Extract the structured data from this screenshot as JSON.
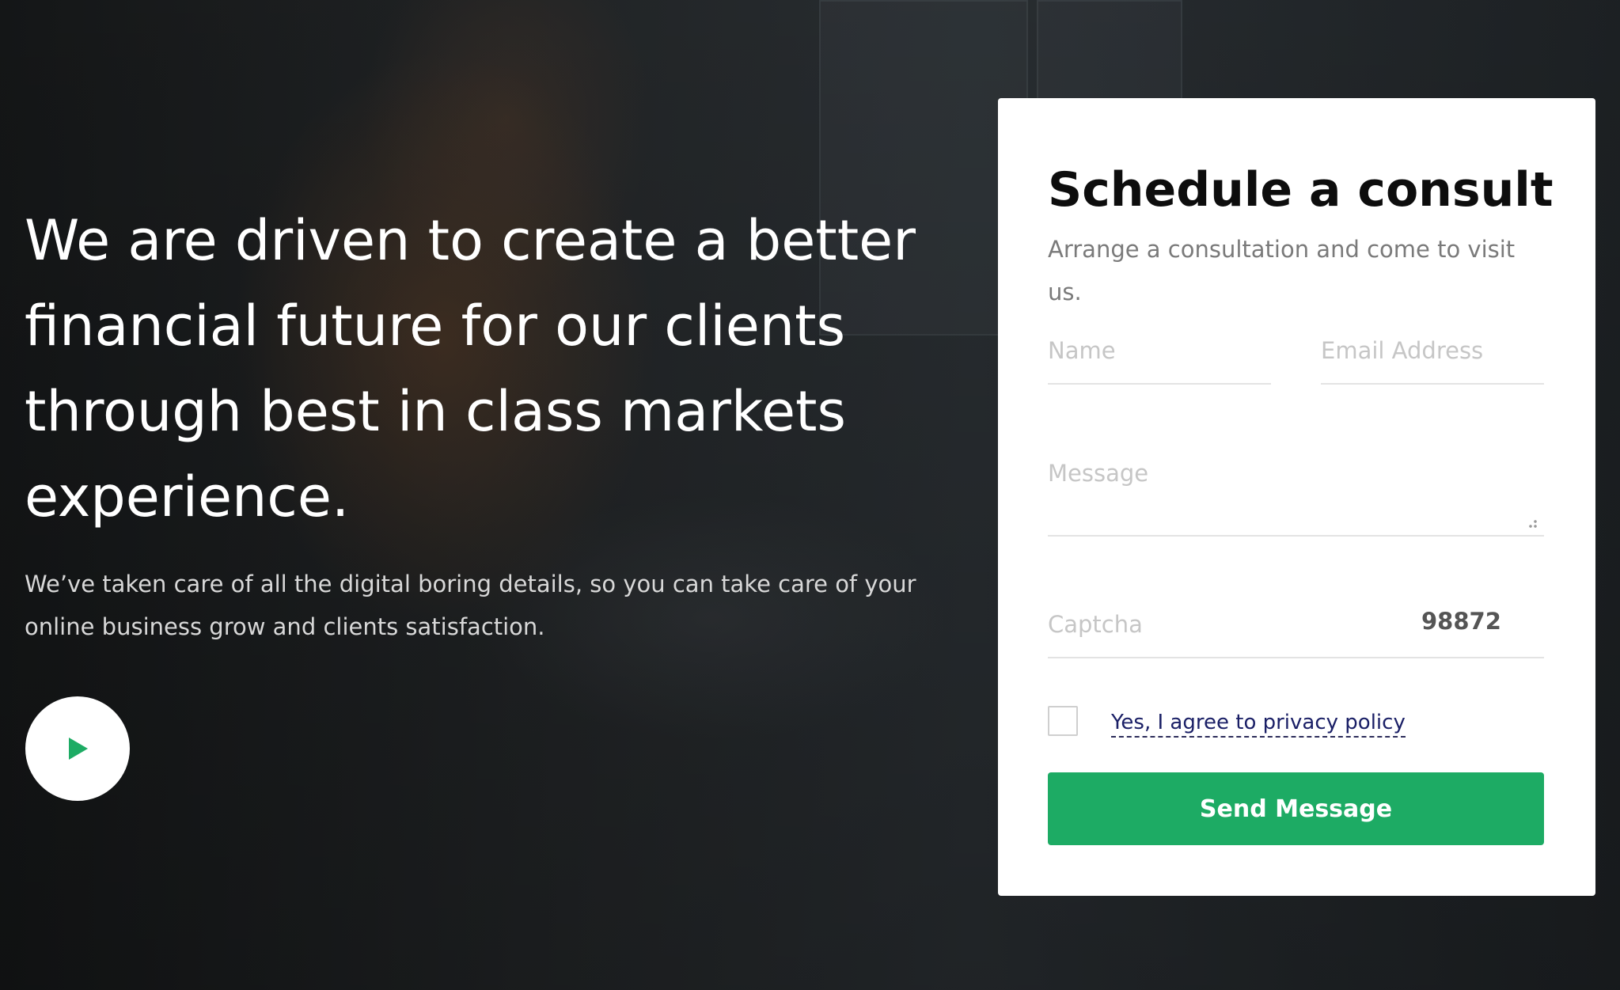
{
  "hero": {
    "headline": "We are driven to create a better financial future for our clients through best in class markets experience.",
    "subtext": "We’ve taken care of all the digital boring details, so you can take care of your online business grow and clients satisfaction.",
    "play_icon": "play-icon"
  },
  "form": {
    "title": "Schedule a consult",
    "description": "Arrange a consultation and come to visit us.",
    "name_placeholder": "Name",
    "email_placeholder": "Email Address",
    "message_placeholder": "Message",
    "captcha_placeholder": "Captcha",
    "captcha_code": "98872",
    "agree_label": "Yes, I agree to privacy policy",
    "submit_label": "Send Message"
  },
  "colors": {
    "accent": "#1dab64",
    "link": "#1a1f66",
    "card_background": "#ffffff"
  }
}
